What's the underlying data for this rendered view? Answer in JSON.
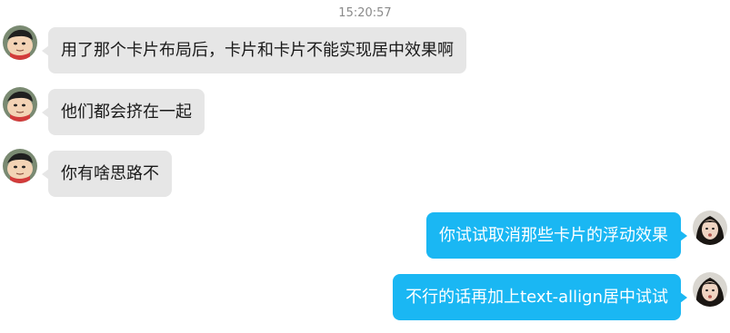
{
  "timestamp": "15:20:57",
  "colors": {
    "incoming_bubble": "#e6e6e6",
    "outgoing_bubble": "#1ab7f3",
    "incoming_text": "#1a1a1a",
    "outgoing_text": "#ffffff",
    "timestamp_text": "#8a8a8a"
  },
  "messages": [
    {
      "direction": "incoming",
      "avatar": "cartoon-boy-avatar",
      "text": "用了那个卡片布局后，卡片和卡片不能实现居中效果啊"
    },
    {
      "direction": "incoming",
      "avatar": "cartoon-boy-avatar",
      "text": "他们都会挤在一起"
    },
    {
      "direction": "incoming",
      "avatar": "cartoon-boy-avatar",
      "text": "你有啥思路不"
    },
    {
      "direction": "outgoing",
      "avatar": "girl-photo-avatar",
      "text": "你试试取消那些卡片的浮动效果"
    },
    {
      "direction": "outgoing",
      "avatar": "girl-photo-avatar",
      "text": "不行的话再加上text-allign居中试试"
    }
  ]
}
